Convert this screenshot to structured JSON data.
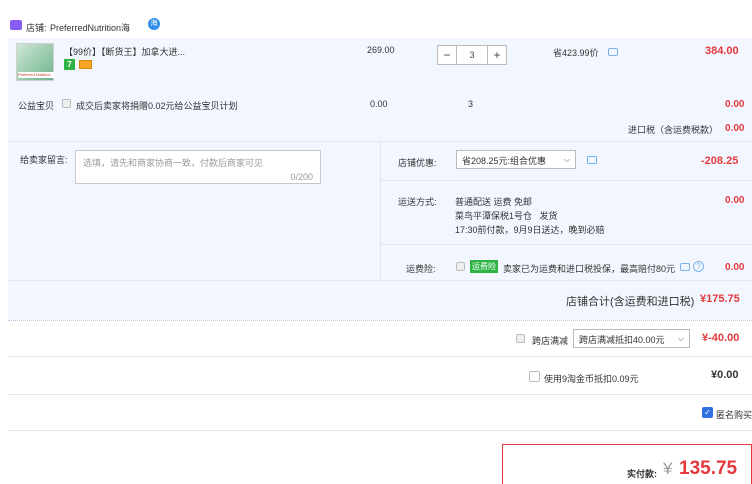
{
  "shop": {
    "label": "店铺:",
    "name": "PreferredNutrition海",
    "hai_badge": "海"
  },
  "product": {
    "title": "【99价】【断货王】加拿大进...",
    "thumb_text": "Preferred Nutrition",
    "unit_price": "269.00",
    "quantity": "3",
    "minus": "−",
    "plus": "+",
    "discount_note": "省423.99价",
    "total": "384.00",
    "badge_7": "7"
  },
  "charity": {
    "label": "公益宝贝",
    "text": "成交后卖家将捐赠0.02元给公益宝贝计划",
    "price": "0.00",
    "qty": "3",
    "total": "0.00"
  },
  "import_tax": {
    "label": "进口税（含运费税款）",
    "value": "0.00"
  },
  "message": {
    "label": "给卖家留言:",
    "placeholder": "选填，请先和商家协商一致，付款后商家可见",
    "counter": "0/200"
  },
  "shop_discount": {
    "label": "店铺优惠:",
    "selected": "省208.25元:组合优惠",
    "value": "-208.25"
  },
  "shipping": {
    "label": "运送方式:",
    "line1": "普通配送 运费 免邮",
    "line2": "菜鸟平潭保税1号仓   发货",
    "line3": "17:30前付款，9月9日送达，晚到必赔",
    "value": "0.00"
  },
  "insurance": {
    "label": "运费险:",
    "badge": "运费险",
    "text": "卖家已为运费和进口税投保，最高赔付80元",
    "value": "0.00"
  },
  "shop_total": {
    "label": "店铺合计(含运费和进口税)",
    "value": "¥175.75"
  },
  "cross_store": {
    "label": "跨店满减",
    "selected": "跨店满减抵扣40.00元",
    "value": "¥-40.00"
  },
  "coins": {
    "label": "使用9淘金币抵扣0.09元",
    "value": "¥0.00"
  },
  "anonymous": {
    "label": "匿名购买"
  },
  "payment": {
    "label": "实付款:",
    "currency": "¥",
    "value": "135.75"
  }
}
